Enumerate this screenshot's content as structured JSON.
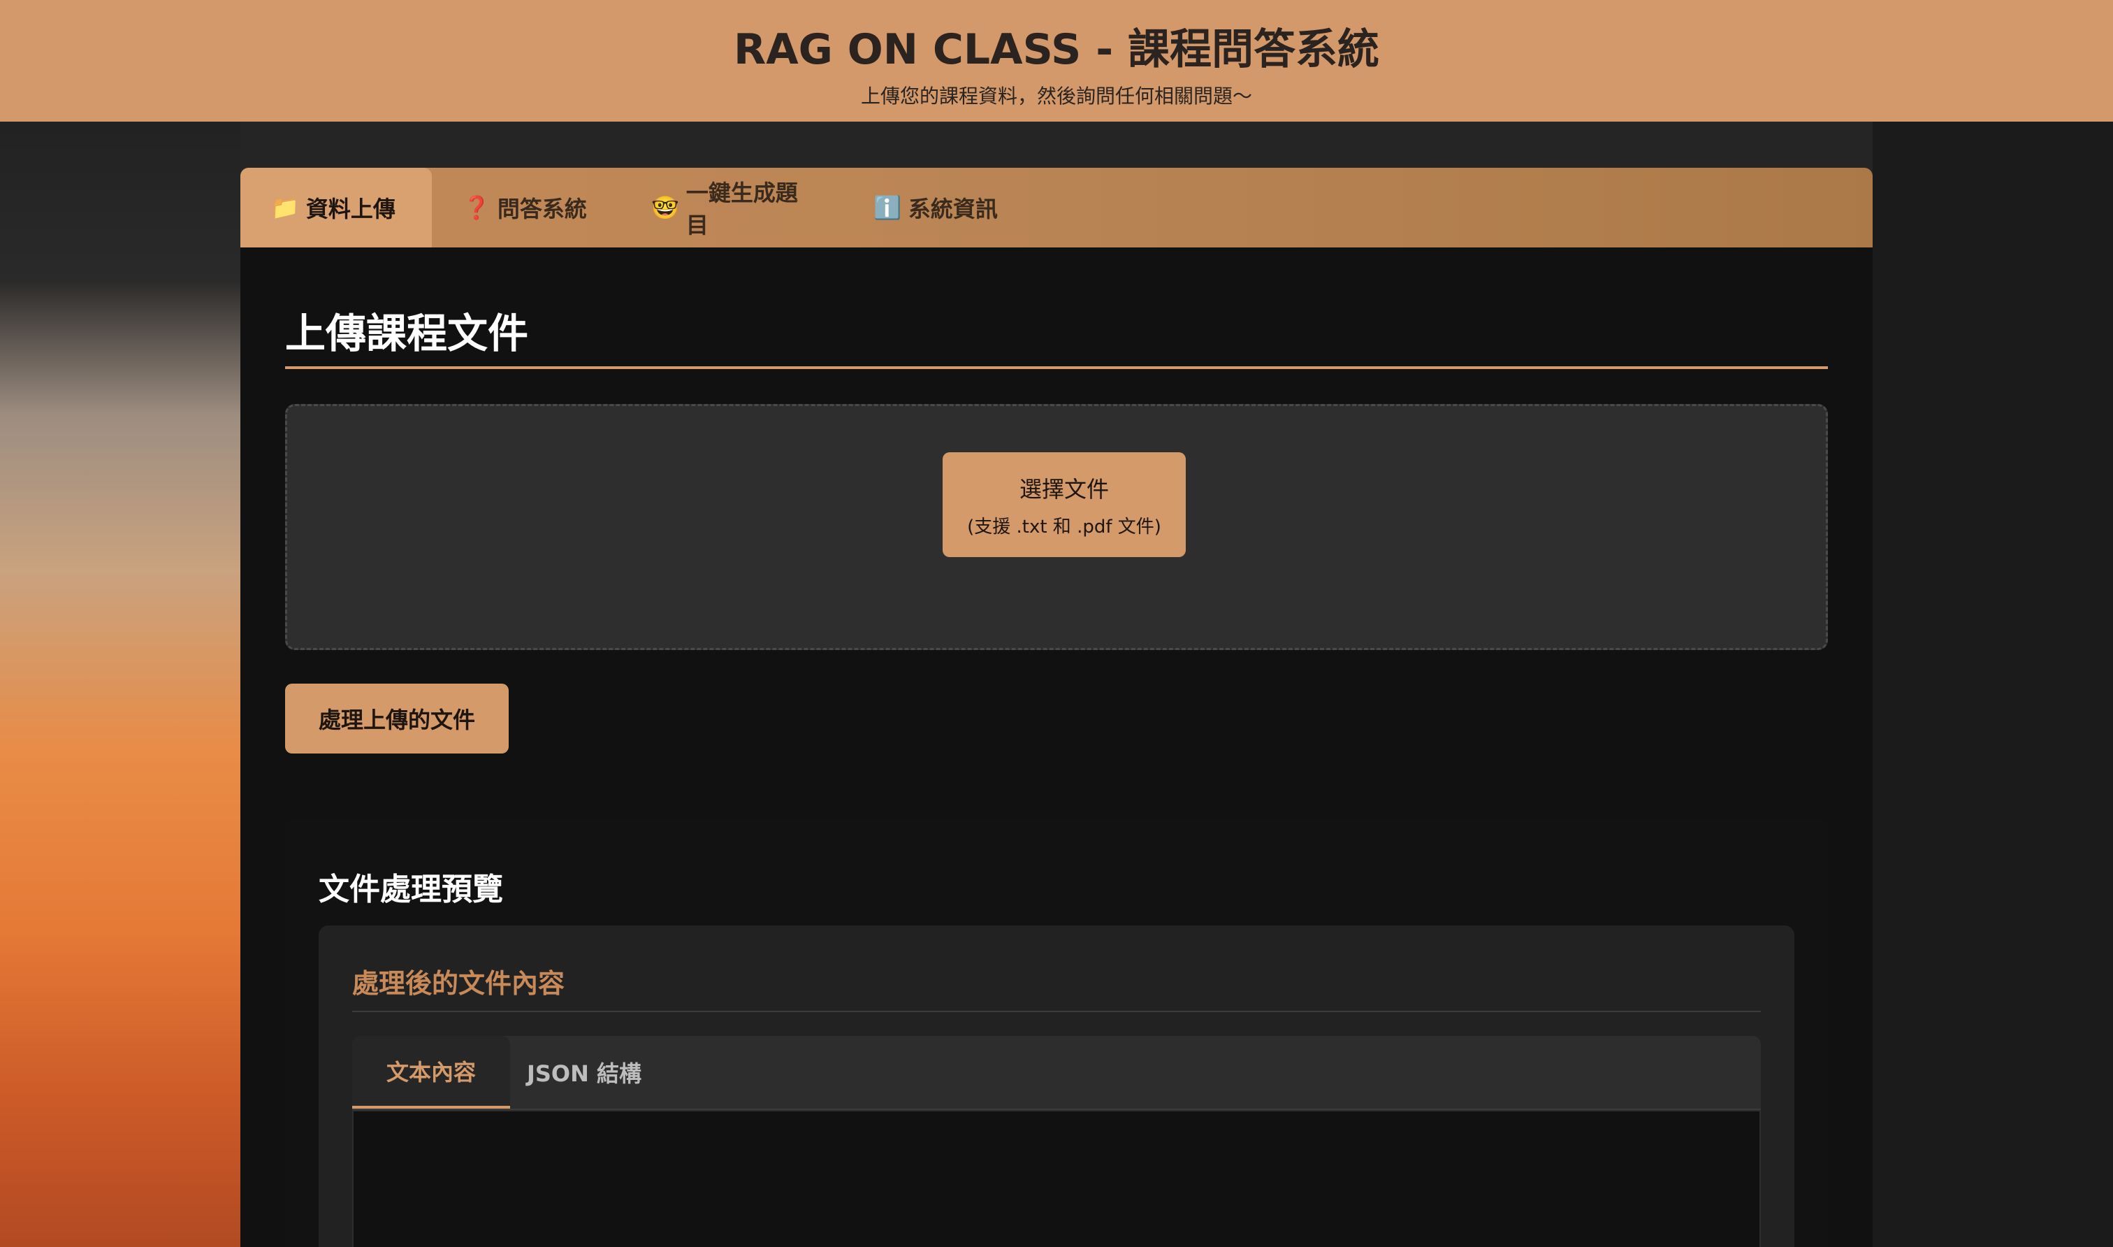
{
  "header": {
    "title": "RAG ON CLASS - 課程問答系統",
    "subtitle": "上傳您的課程資料，然後詢問任何相關問題〜"
  },
  "tabs": [
    {
      "icon": "📁",
      "label": "資料上傳",
      "active": true
    },
    {
      "icon": "❓",
      "label": "問答系統",
      "active": false
    },
    {
      "icon": "🤓",
      "label": "一鍵生成題目",
      "active": false
    },
    {
      "icon": "ℹ️",
      "label": "系統資訊",
      "active": false
    }
  ],
  "upload": {
    "section_title": "上傳課程文件",
    "choose_label": "選擇文件",
    "choose_hint": "(支援 .txt 和 .pdf 文件)",
    "process_label": "處理上傳的文件"
  },
  "preview": {
    "title": "文件處理預覽",
    "card_title": "處理後的文件內容",
    "subtabs": [
      {
        "label": "文本內容",
        "active": true
      },
      {
        "label": "JSON 結構",
        "active": false
      }
    ]
  },
  "colors": {
    "accent": "#d49a6a",
    "header_bg": "#d3996a",
    "panel_bg": "#111111"
  }
}
